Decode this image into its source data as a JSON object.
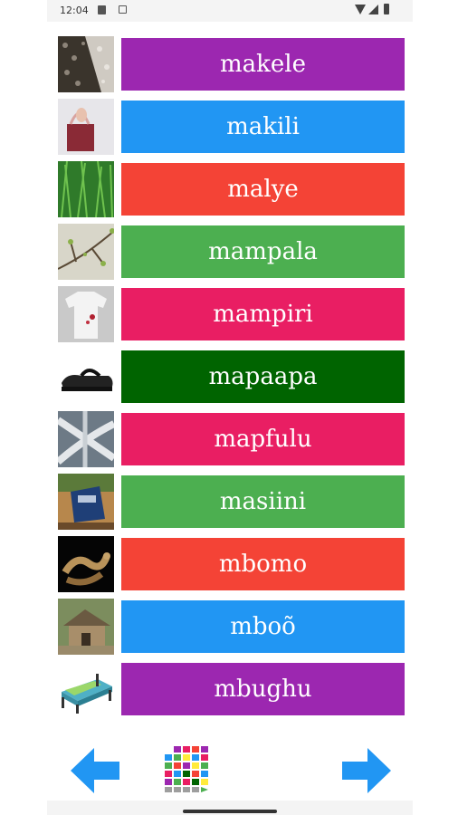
{
  "status_bar": {
    "time": "12:04",
    "icons": [
      "notification-icon",
      "app-icon",
      "wifi-icon",
      "signal-icon",
      "battery-icon"
    ]
  },
  "words": [
    {
      "label": "makele",
      "color": "#9C27B0",
      "icon": "gravel-icon"
    },
    {
      "label": "makili",
      "color": "#2196F3",
      "icon": "bag-icon"
    },
    {
      "label": "malye",
      "color": "#F44336",
      "icon": "grass-icon"
    },
    {
      "label": "mampala",
      "color": "#4CAF50",
      "icon": "branch-buds-icon"
    },
    {
      "label": "mampiri",
      "color": "#E91E63",
      "icon": "stained-shirt-icon"
    },
    {
      "label": "mapaapa",
      "color": "#006400",
      "icon": "sandal-icon"
    },
    {
      "label": "mapfulu",
      "color": "#E91E63",
      "icon": "crossroads-icon"
    },
    {
      "label": "masiini",
      "color": "#4CAF50",
      "icon": "train-icon"
    },
    {
      "label": "mbomo",
      "color": "#F44336",
      "icon": "snake-icon"
    },
    {
      "label": "mboõ",
      "color": "#2196F3",
      "icon": "hut-icon"
    },
    {
      "label": "mbughu",
      "color": "#9C27B0",
      "icon": "bed-icon"
    }
  ],
  "navigation": {
    "prev_icon": "arrow-left-icon",
    "next_icon": "arrow-right-icon",
    "grid_icon": "alphabet-grid-icon",
    "arrow_color": "#2196F3"
  }
}
